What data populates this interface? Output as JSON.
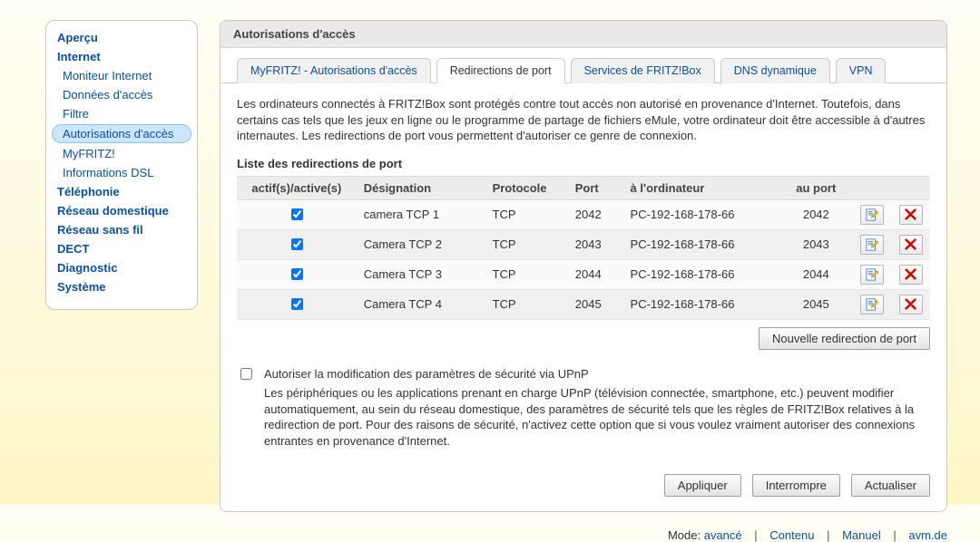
{
  "sidebar": {
    "top": [
      {
        "label": "Aperçu"
      },
      {
        "label": "Internet",
        "children": [
          {
            "label": "Moniteur Internet"
          },
          {
            "label": "Données d'accès"
          },
          {
            "label": "Filtre"
          },
          {
            "label": "Autorisations d'accès",
            "selected": true
          },
          {
            "label": "MyFRITZ!"
          },
          {
            "label": "Informations DSL"
          }
        ]
      },
      {
        "label": "Téléphonie"
      },
      {
        "label": "Réseau domestique"
      },
      {
        "label": "Réseau sans fil"
      },
      {
        "label": "DECT"
      },
      {
        "label": "Diagnostic"
      },
      {
        "label": "Système"
      }
    ]
  },
  "panel": {
    "title": "Autorisations d'accès",
    "tabs": [
      {
        "label": "MyFRITZ! - Autorisations d'accès"
      },
      {
        "label": "Redirections de port",
        "active": true
      },
      {
        "label": "Services de FRITZ!Box"
      },
      {
        "label": "DNS dynamique"
      },
      {
        "label": "VPN"
      }
    ],
    "intro": "Les ordinateurs connectés à FRITZ!Box sont protégés contre tout accès non autorisé en provenance d'Internet. Toutefois, dans certains cas tels que les jeux en ligne ou le programme de partage de fichiers eMule, votre ordinateur doit être accessible à d'autres internautes. Les redirections de port vous permettent d'autoriser ce genre de connexion.",
    "list_title": "Liste des redirections de port",
    "columns": {
      "active": "actif(s)/active(s)",
      "name": "Désignation",
      "proto": "Protocole",
      "port": "Port",
      "host": "à l'ordinateur",
      "to_port": "au port"
    },
    "rows": [
      {
        "active": true,
        "name": "camera TCP 1",
        "proto": "TCP",
        "port": "2042",
        "host": "PC-192-168-178-66",
        "to_port": "2042"
      },
      {
        "active": true,
        "name": "Camera TCP 2",
        "proto": "TCP",
        "port": "2043",
        "host": "PC-192-168-178-66",
        "to_port": "2043"
      },
      {
        "active": true,
        "name": "Camera TCP 3",
        "proto": "TCP",
        "port": "2044",
        "host": "PC-192-168-178-66",
        "to_port": "2044"
      },
      {
        "active": true,
        "name": "Camera TCP 4",
        "proto": "TCP",
        "port": "2045",
        "host": "PC-192-168-178-66",
        "to_port": "2045"
      }
    ],
    "new_button": "Nouvelle redirection de port",
    "upnp": {
      "checkbox_label": "Autoriser la modification des paramètres de sécurité via UPnP",
      "description": "Les périphériques ou les applications prenant en charge UPnP (télévision connectée, smartphone, etc.) peuvent modifier automatiquement, au sein du réseau domestique, des paramètres de sécurité tels que les règles de FRITZ!Box relatives à la redirection de port. Pour des raisons de sécurité, n'activez cette option que si vous voulez vraiment autoriser des connexions entrantes en provenance d'Internet.",
      "checked": false
    },
    "buttons": {
      "apply": "Appliquer",
      "cancel": "Interrompre",
      "refresh": "Actualiser"
    }
  },
  "footer": {
    "mode_label": "Mode:",
    "mode_value": "avancé",
    "links": [
      "Contenu",
      "Manuel",
      "avm.de"
    ]
  }
}
